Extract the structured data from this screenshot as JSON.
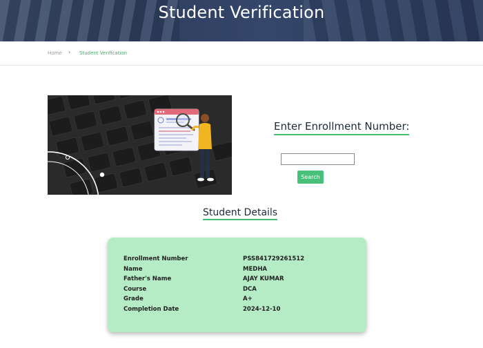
{
  "header": {
    "title": "Student Verification"
  },
  "breadcrumb": {
    "home": "Home",
    "separator": "›",
    "current": "Student Verification"
  },
  "verify_form": {
    "heading": "Enter Enrollment Number:",
    "input_value": "",
    "input_placeholder": "",
    "search_label": "Search"
  },
  "details": {
    "heading": "Student Details",
    "rows": [
      {
        "label": "Enrollment Number",
        "value": "PSS841729261512"
      },
      {
        "label": "Name",
        "value": "MEDHA"
      },
      {
        "label": "Father's Name",
        "value": "AJAY KUMAR"
      },
      {
        "label": "Course",
        "value": "DCA"
      },
      {
        "label": "Grade",
        "value": "A+"
      },
      {
        "label": "Completion Date",
        "value": "2024-12-10"
      }
    ]
  },
  "colors": {
    "accent_green": "#48c07a",
    "card_bg": "#b5ecc6",
    "header_bg": "#34466a"
  },
  "icons": {
    "breadcrumb_separator": "chevron-right-icon",
    "illustration": "magnifier-document-illustration"
  }
}
